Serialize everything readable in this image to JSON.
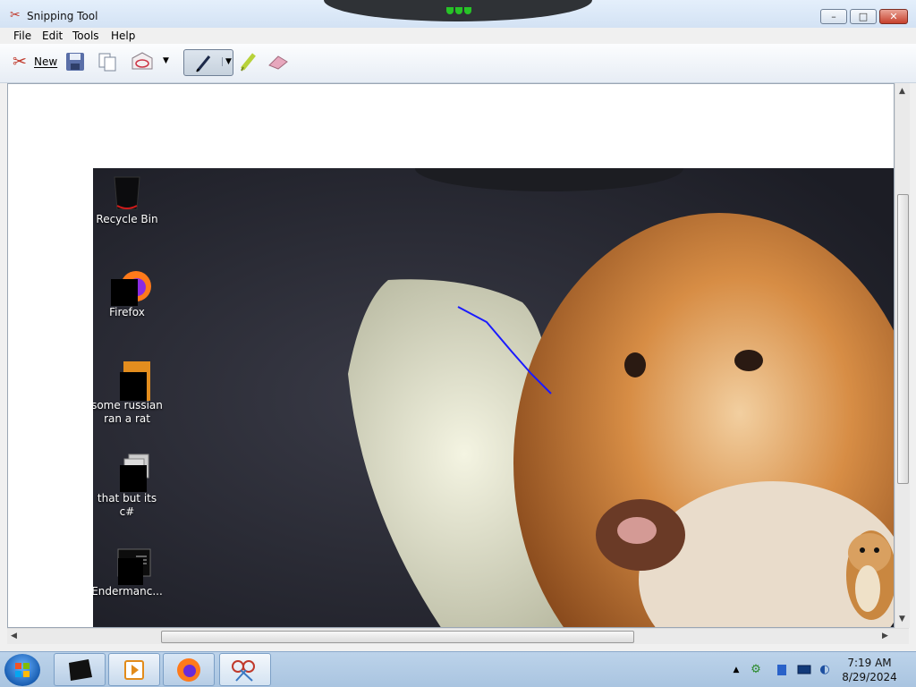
{
  "window": {
    "title": "Snipping Tool",
    "app_icon": "scissors-icon"
  },
  "controls": {
    "minimize": "–",
    "maximize": "□",
    "close": "✕"
  },
  "menus": [
    "File",
    "Edit",
    "Tools",
    "Help"
  ],
  "toolbar": {
    "new_label": "New",
    "new_icon": "scissors-icon",
    "save_icon": "save-icon",
    "copy_icon": "copy-icon",
    "send_icon": "send-icon",
    "pen_icon": "pen-icon",
    "highlighter_icon": "highlighter-icon",
    "eraser_icon": "eraser-icon"
  },
  "snip": {
    "desktop_icons": [
      {
        "label": "Recycle Bin",
        "icon": "recycle-bin-icon"
      },
      {
        "label": "Firefox",
        "icon": "firefox-icon"
      },
      {
        "label": "some russian ran a rat",
        "icon": "document-icon"
      },
      {
        "label": "that but its c#",
        "icon": "stack-icon"
      },
      {
        "label": "Endermanc...",
        "icon": "terminal-icon"
      }
    ],
    "annotation_color": "#1a1aff"
  },
  "taskbar": {
    "time": "7:19 AM",
    "date": "8/29/2024",
    "apps": [
      "folder-icon",
      "media-player-icon",
      "firefox-icon",
      "snipping-tool-icon"
    ],
    "tray_icons": [
      "chevron-up-icon",
      "network-icon",
      "notes-icon",
      "display-icon",
      "sound-icon"
    ]
  },
  "colors": {
    "accent": "#1a5fb3",
    "close": "#c7402c",
    "window_frame": "#d3e2f4"
  }
}
